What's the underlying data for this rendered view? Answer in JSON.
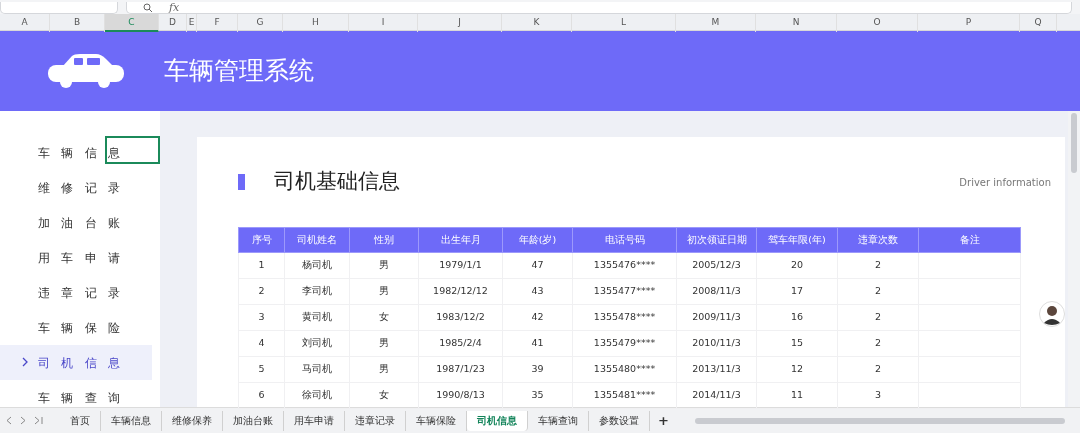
{
  "formula_bar": {
    "function_label": "fx"
  },
  "column_headers": [
    {
      "label": "A",
      "selected": false
    },
    {
      "label": "B",
      "selected": false
    },
    {
      "label": "C",
      "selected": true
    },
    {
      "label": "D",
      "selected": false
    },
    {
      "label": "E",
      "selected": false
    },
    {
      "label": "F",
      "selected": false
    },
    {
      "label": "G",
      "selected": false
    },
    {
      "label": "H",
      "selected": false
    },
    {
      "label": "I",
      "selected": false
    },
    {
      "label": "J",
      "selected": false
    },
    {
      "label": "K",
      "selected": false
    },
    {
      "label": "L",
      "selected": false
    },
    {
      "label": "M",
      "selected": false
    },
    {
      "label": "N",
      "selected": false
    },
    {
      "label": "O",
      "selected": false
    },
    {
      "label": "P",
      "selected": false
    },
    {
      "label": "Q",
      "selected": false
    }
  ],
  "banner": {
    "title": "车辆管理系统"
  },
  "sidebar": {
    "items": [
      {
        "label": "车辆信息",
        "selected": false
      },
      {
        "label": "维修记录",
        "selected": false
      },
      {
        "label": "加油台账",
        "selected": false
      },
      {
        "label": "用车申请",
        "selected": false
      },
      {
        "label": "违章记录",
        "selected": false
      },
      {
        "label": "车辆保险",
        "selected": false
      },
      {
        "label": "司机信息",
        "selected": true
      },
      {
        "label": "车辆查询",
        "selected": false
      }
    ]
  },
  "page": {
    "title": "司机基础信息",
    "subtitle": "Driver information"
  },
  "table": {
    "columns": [
      "序号",
      "司机姓名",
      "性别",
      "出生年月",
      "年龄(岁)",
      "电话号码",
      "初次领证日期",
      "驾车年限(年)",
      "违章次数",
      "备注"
    ],
    "rows": [
      [
        "1",
        "杨司机",
        "男",
        "1979/1/1",
        "47",
        "1355476****",
        "2005/12/3",
        "20",
        "2",
        ""
      ],
      [
        "2",
        "李司机",
        "男",
        "1982/12/12",
        "43",
        "1355477****",
        "2008/11/3",
        "17",
        "2",
        ""
      ],
      [
        "3",
        "黄司机",
        "女",
        "1983/12/2",
        "42",
        "1355478****",
        "2009/11/3",
        "16",
        "2",
        ""
      ],
      [
        "4",
        "刘司机",
        "男",
        "1985/2/4",
        "41",
        "1355479****",
        "2010/11/3",
        "15",
        "2",
        ""
      ],
      [
        "5",
        "马司机",
        "男",
        "1987/1/23",
        "39",
        "1355480****",
        "2013/11/3",
        "12",
        "2",
        ""
      ],
      [
        "6",
        "徐司机",
        "女",
        "1990/8/13",
        "35",
        "1355481****",
        "2014/11/3",
        "11",
        "3",
        ""
      ]
    ]
  },
  "sheet_tabs": [
    {
      "label": "首页",
      "selected": false
    },
    {
      "label": "车辆信息",
      "selected": false
    },
    {
      "label": "维修保养",
      "selected": false
    },
    {
      "label": "加油台账",
      "selected": false
    },
    {
      "label": "用车申请",
      "selected": false
    },
    {
      "label": "违章记录",
      "selected": false
    },
    {
      "label": "车辆保险",
      "selected": false
    },
    {
      "label": "司机信息",
      "selected": true
    },
    {
      "label": "车辆查询",
      "selected": false
    },
    {
      "label": "参数设置",
      "selected": false
    }
  ],
  "add_sheet": "+"
}
